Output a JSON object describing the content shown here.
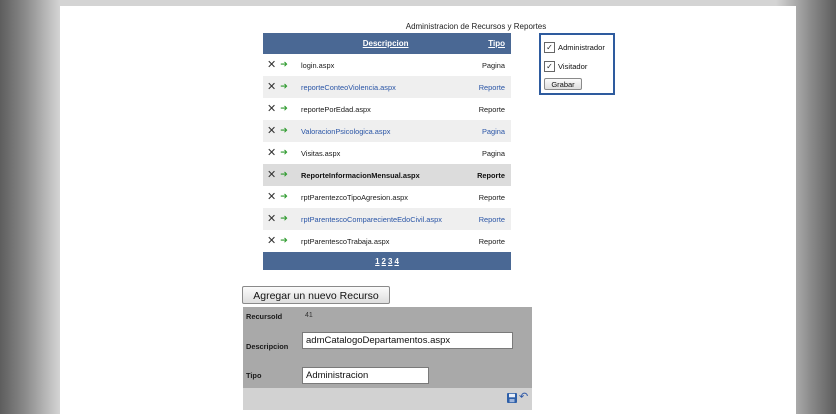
{
  "grid": {
    "title": "Administracion de Recursos y Reportes",
    "headers": {
      "descripcion": "Descripcion",
      "tipo": "Tipo"
    },
    "rows": [
      {
        "descripcion": "login.aspx",
        "tipo": "Pagina"
      },
      {
        "descripcion": "reporteConteoViolencia.aspx",
        "tipo": "Reporte"
      },
      {
        "descripcion": "reportePorEdad.aspx",
        "tipo": "Reporte"
      },
      {
        "descripcion": "ValoracionPsicologica.aspx",
        "tipo": "Pagina"
      },
      {
        "descripcion": "Visitas.aspx",
        "tipo": "Pagina"
      },
      {
        "descripcion": "ReporteInformacionMensual.aspx",
        "tipo": "Reporte"
      },
      {
        "descripcion": "rptParentezcoTipoAgresion.aspx",
        "tipo": "Reporte"
      },
      {
        "descripcion": "rptParentescoComparecienteEdoCivil.aspx",
        "tipo": "Reporte"
      },
      {
        "descripcion": "rptParentescoTrabaja.aspx",
        "tipo": "Reporte"
      }
    ],
    "selected_row": 5,
    "pager": [
      "1",
      "2",
      "3",
      "4"
    ]
  },
  "roles": {
    "items": [
      {
        "label": "Administrador",
        "checked": true
      },
      {
        "label": "Visitador",
        "checked": true
      }
    ],
    "save_label": "Grabar"
  },
  "add_button_label": "Agregar un nuevo Recurso",
  "form": {
    "recurso_id_label": "RecursoId",
    "recurso_id_value": "41",
    "descripcion_label": "Descripcion",
    "descripcion_value": "admCatalogoDepartamentos.aspx",
    "tipo_label": "Tipo",
    "tipo_value": "Administracion"
  },
  "icons": {
    "delete": "close-x-icon",
    "select": "green-arrow-icon",
    "save": "floppy-disk-icon",
    "cancel": "undo-arrow-icon"
  },
  "colors": {
    "grid_header": "#4a6894",
    "roles_border": "#2e5b9e",
    "link_blue": "#2a55a6",
    "form_background": "#a9a9a9"
  }
}
